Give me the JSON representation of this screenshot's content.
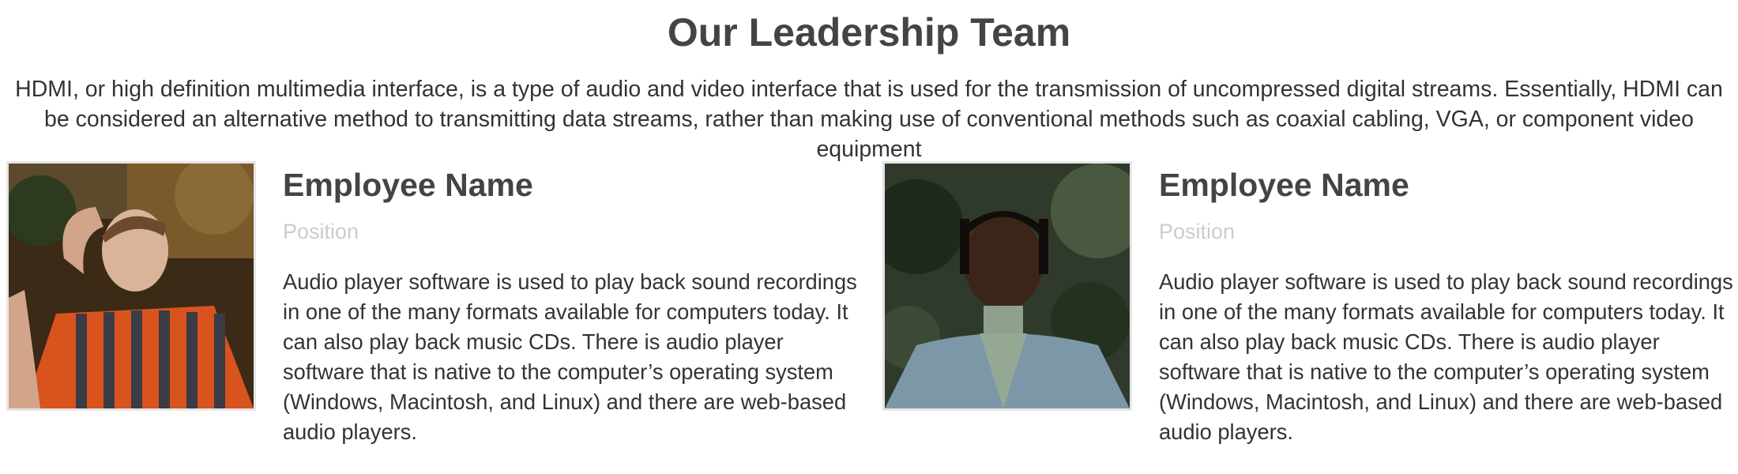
{
  "page": {
    "title": "Our Leadership Team",
    "intro": "HDMI, or high definition multimedia interface, is a type of audio and video interface that is used for the transmission of uncompressed digital streams. Essentially, HDMI can be considered an alternative method to transmitting data streams, rather than making use of conventional methods such as coaxial cabling, VGA, or component video equipment"
  },
  "team": [
    {
      "name": "Employee Name",
      "position": "Position",
      "bio": "Audio player software is used to play back sound recordings in one of the many formats available for computers today. It can also play back music CDs. There is audio player software that is native to the computer’s operating system (Windows, Macintosh, and Linux) and there are web-based audio players."
    },
    {
      "name": "Employee Name",
      "position": "Position",
      "bio": "Audio player software is used to play back sound recordings in one of the many formats available for computers today. It can also play back music CDs. There is audio player software that is native to the computer’s operating system (Windows, Macintosh, and Linux) and there are web-based audio players."
    }
  ],
  "colors": {
    "heading": "#444444",
    "body_text": "#333333",
    "muted": "#cccccc",
    "photo_border": "#e6e6e6"
  }
}
